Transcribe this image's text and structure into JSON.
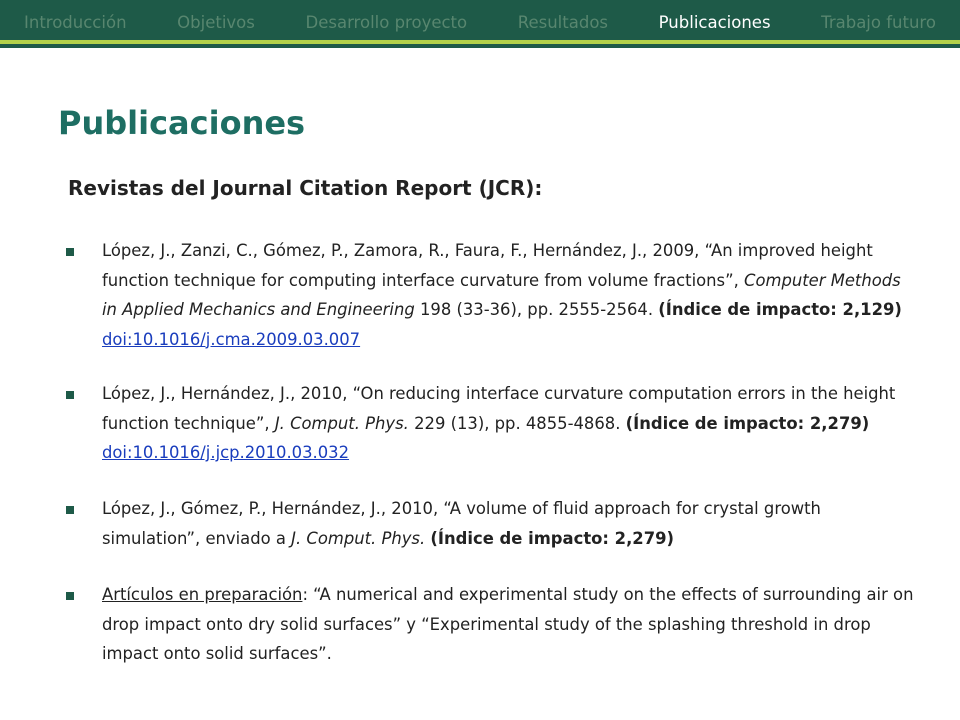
{
  "nav": {
    "tabs": [
      "Introducción",
      "Objetivos",
      "Desarrollo proyecto",
      "Resultados",
      "Publicaciones",
      "Trabajo futuro"
    ],
    "active": "Publicaciones"
  },
  "colors": {
    "bar": "#1e5a48",
    "accent_line": "#b3d14a",
    "title": "#1e6e63",
    "link": "#1a3dbd"
  },
  "page": {
    "title": "Publicaciones",
    "subtitle": "Revistas del Journal Citation Report (JCR):"
  },
  "publications": [
    {
      "authors": "López, J., Zanzi, C., Gómez, P., Zamora, R., Faura, F., Hernández, J., 2009, ",
      "title": "“An improved height function technique for computing interface curvature from volume fractions”, ",
      "journal": "Computer Methods in Applied Mechanics and Engineering",
      "details": " 198 (33-36), pp. 2555-2564. ",
      "impact": "(Índice de impacto: 2,129)",
      "doi": "doi:10.1016/j.cma.2009.03.007"
    },
    {
      "authors": "López, J., Hernández, J., 2010, ",
      "title": "“On reducing interface curvature computation errors in the height function technique”, ",
      "journal": "J. Comput. Phys.",
      "details": " 229 (13), pp. 4855-4868. ",
      "impact": "(Índice de impacto: 2,279)",
      "doi": "doi:10.1016/j.jcp.2010.03.032"
    },
    {
      "authors": "López, J., Gómez, P., Hernández, J., 2010, ",
      "title": "“A volume of fluid approach for crystal growth simulation”, enviado a ",
      "journal": "J. Comput. Phys.",
      "details": " ",
      "impact": "(Índice de impacto: 2,279)"
    }
  ],
  "in_preparation": {
    "label": "Artículos en preparación",
    "text": ": “A numerical and experimental study on the effects of surrounding air on drop impact onto dry solid surfaces” y “Experimental study of the splashing threshold in drop impact onto solid surfaces”."
  }
}
